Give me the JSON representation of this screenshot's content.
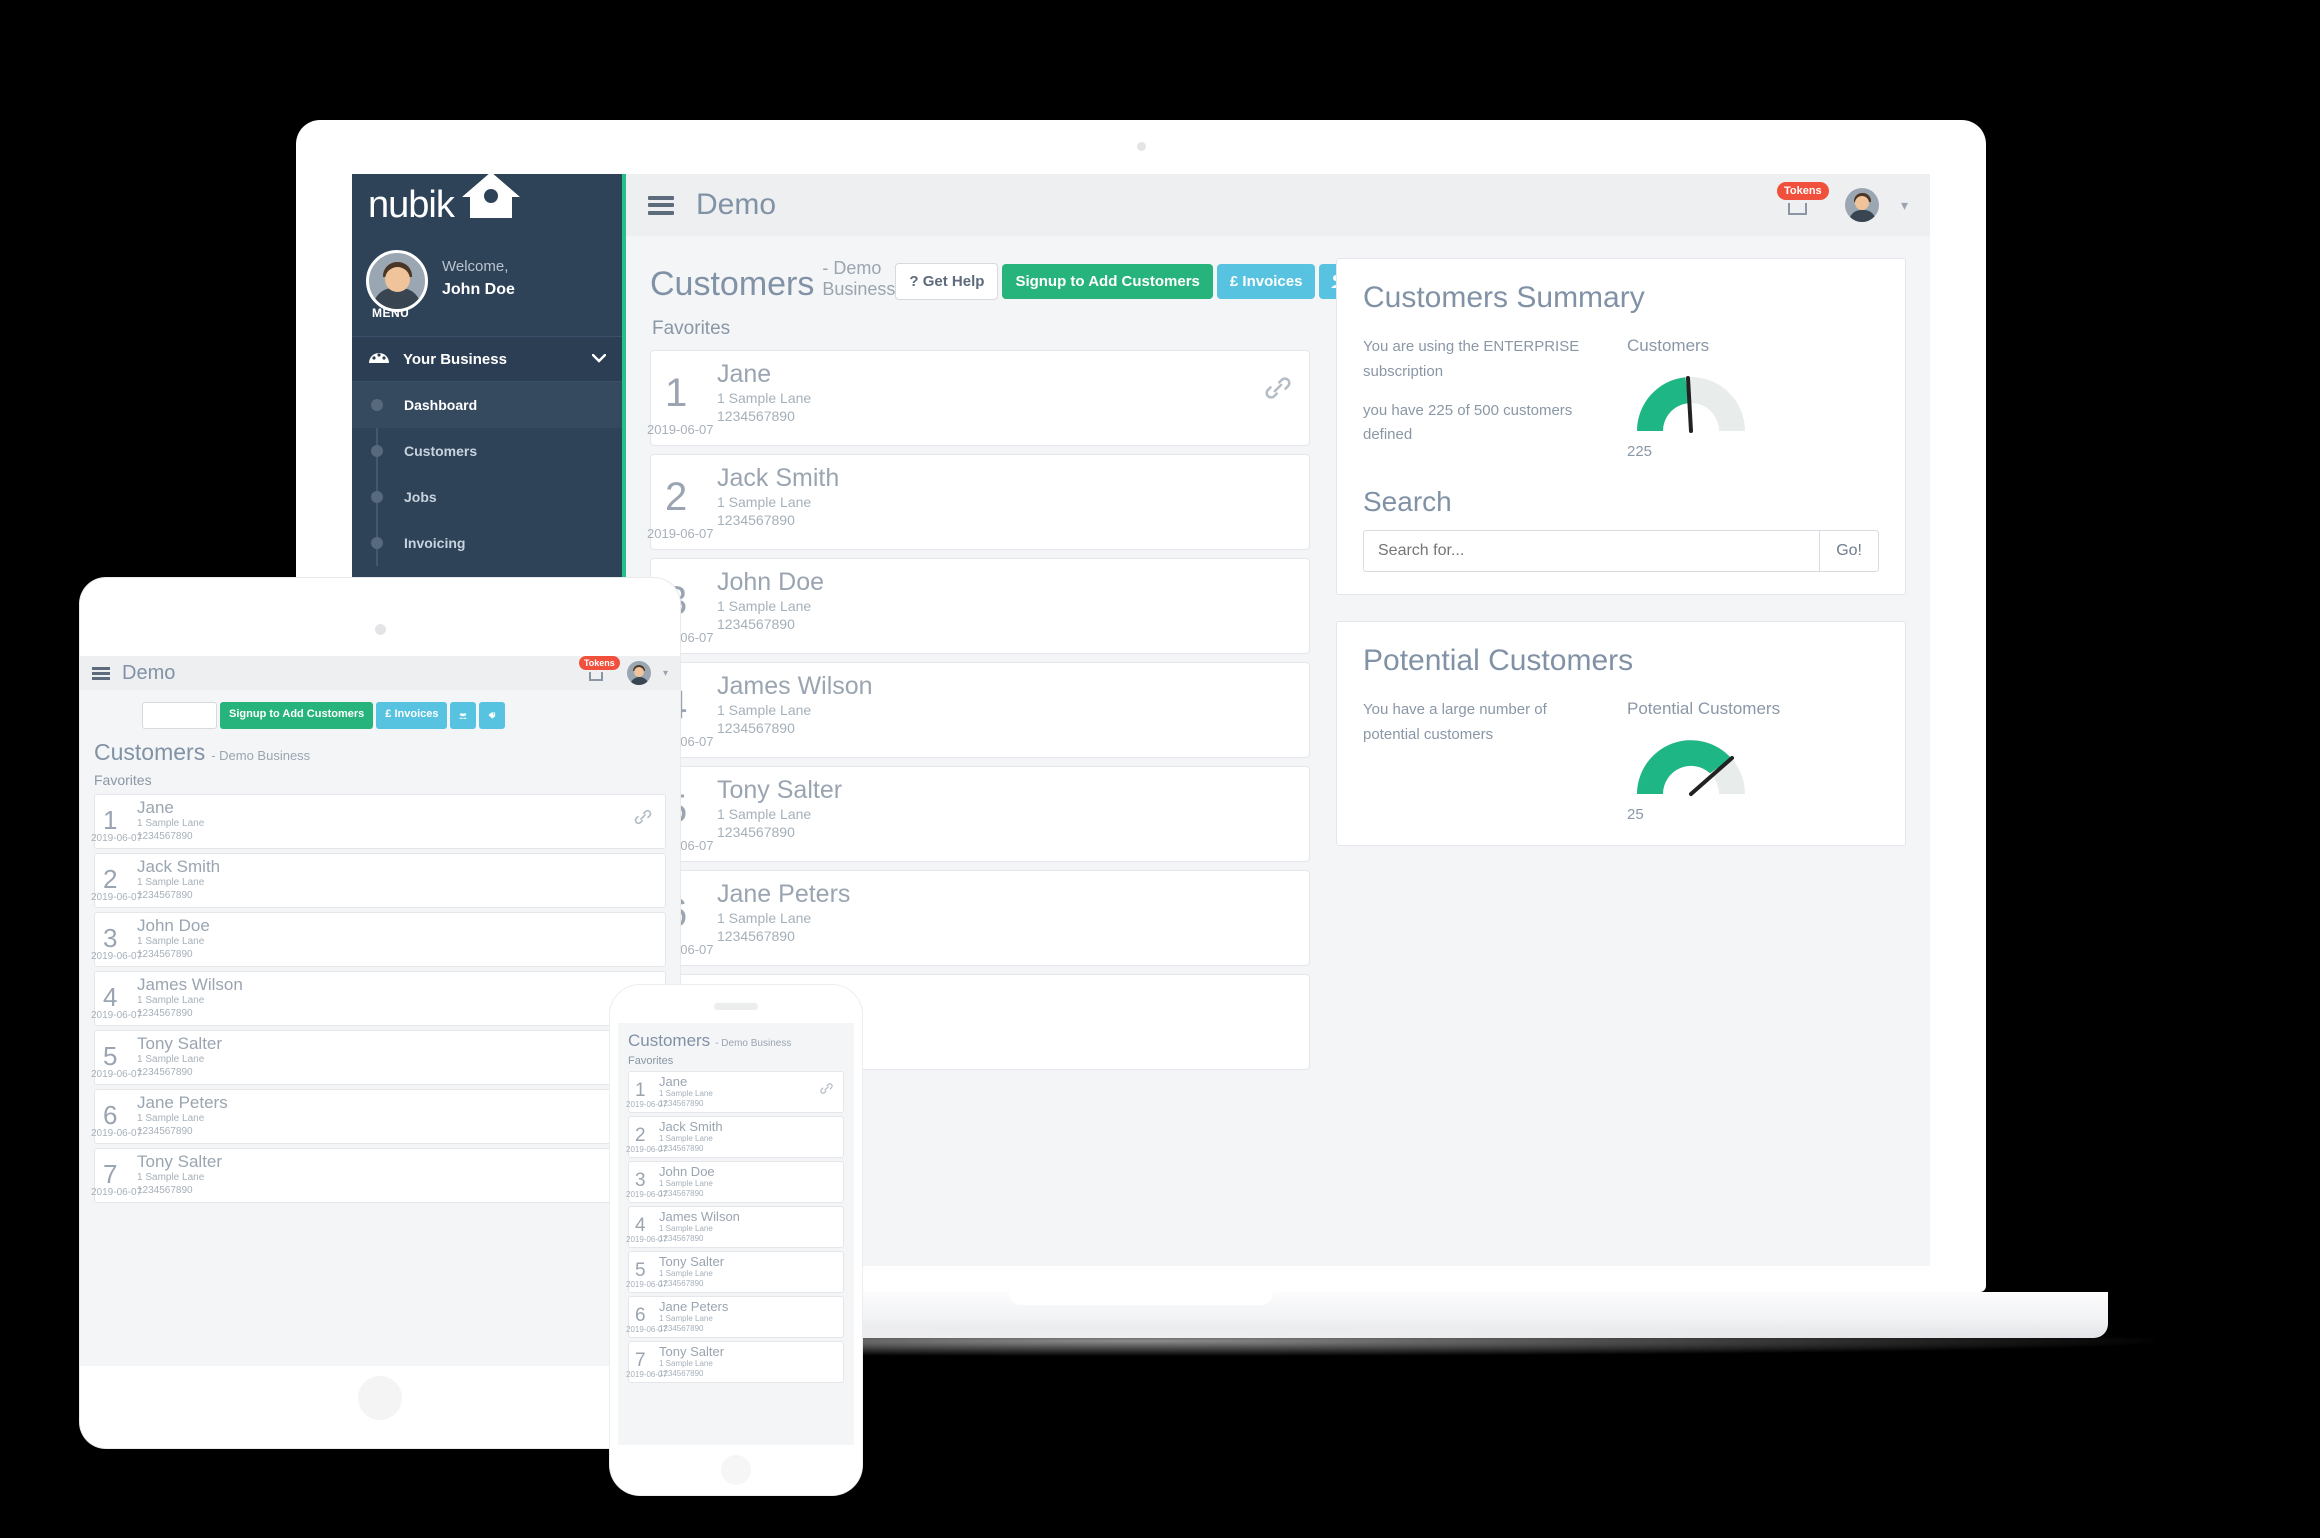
{
  "brand": {
    "word": "nubik",
    "logo_icon": "house-icon"
  },
  "sidebar": {
    "welcome_label": "Welcome,",
    "user_name": "John Doe",
    "menu_label": "MENU",
    "group": {
      "label": "Your Business",
      "icon": "dashboard-gauge-icon",
      "chevron": "chevron-down-icon"
    },
    "items": [
      {
        "label": "Dashboard",
        "active": true
      },
      {
        "label": "Customers",
        "active": false
      },
      {
        "label": "Jobs",
        "active": false
      },
      {
        "label": "Invoicing",
        "active": false
      }
    ],
    "accent_color": "#25c08a",
    "bg_color": "#2e4258"
  },
  "topbar": {
    "menu_icon": "hamburger-icon",
    "title": "Demo",
    "tokens_badge": "Tokens",
    "cart_icon": "shopping-cart-icon",
    "avatar_icon": "user-avatar",
    "caret_icon": "chevron-down-icon"
  },
  "page": {
    "title": "Customers",
    "subtitle": "- Demo Business",
    "favorites_label": "Favorites"
  },
  "toolbar": {
    "get_help": "? Get Help",
    "signup": "Signup to Add Customers",
    "invoices": "£ Invoices",
    "group_icon": "users-group-icon",
    "tag_icon": "tag-icon",
    "green": "#27b47c",
    "blue": "#57c3e0"
  },
  "customers": [
    {
      "num": "1",
      "name": "Jane",
      "address": "1 Sample Lane",
      "phone": "1234567890",
      "date": "2019-06-07",
      "linked": true
    },
    {
      "num": "2",
      "name": "Jack Smith",
      "address": "1 Sample Lane",
      "phone": "1234567890",
      "date": "2019-06-07",
      "linked": false
    },
    {
      "num": "3",
      "name": "John Doe",
      "address": "1 Sample Lane",
      "phone": "1234567890",
      "date": "2019-06-07",
      "linked": false
    },
    {
      "num": "4",
      "name": "James Wilson",
      "address": "1 Sample Lane",
      "phone": "1234567890",
      "date": "2019-06-07",
      "linked": false
    },
    {
      "num": "5",
      "name": "Tony Salter",
      "address": "1 Sample Lane",
      "phone": "1234567890",
      "date": "2019-06-07",
      "linked": false
    },
    {
      "num": "6",
      "name": "Jane Peters",
      "address": "1 Sample Lane",
      "phone": "1234567890",
      "date": "2019-06-07",
      "linked": false
    },
    {
      "num": "7",
      "name": "Tony Salter",
      "address": "1 Sample Lane",
      "phone": "1234567890",
      "date": "2019-06-07",
      "linked": false
    }
  ],
  "summary": {
    "heading": "Customers Summary",
    "subscription_text": "You are using the ENTERPRISE subscription",
    "count_text": "you have 225 of 500 customers defined",
    "gauge_title": "Customers",
    "gauge_value": "225"
  },
  "search": {
    "heading": "Search",
    "placeholder": "Search for...",
    "button": "Go!",
    "value": ""
  },
  "potential": {
    "heading": "Potential Customers",
    "text": "You have a large number of potential customers",
    "gauge_title": "Potential Customers",
    "gauge_value": "25"
  },
  "chart_data": [
    {
      "type": "gauge",
      "title": "Customers",
      "value": 225,
      "max": 500,
      "min": 0,
      "fill_color": "#1fb686",
      "track_color": "#e8edec",
      "needle_color": "#222222",
      "label": "225"
    },
    {
      "type": "gauge",
      "title": "Potential Customers",
      "value": 25,
      "max": 40,
      "min": 0,
      "fill_color": "#1fb686",
      "track_color": "#e8edec",
      "needle_color": "#222222",
      "label": "25"
    }
  ]
}
